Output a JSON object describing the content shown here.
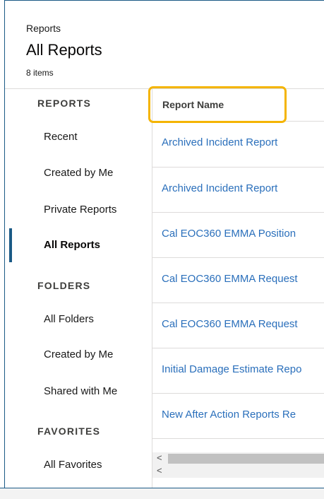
{
  "header": {
    "breadcrumb": "Reports",
    "title": "All Reports",
    "item_count": "8 items"
  },
  "sidebar": {
    "reports_heading": "REPORTS",
    "reports_items": [
      "Recent",
      "Created by Me",
      "Private Reports",
      "All Reports"
    ],
    "folders_heading": "FOLDERS",
    "folders_items": [
      "All Folders",
      "Created by Me",
      "Shared with Me"
    ],
    "favorites_heading": "FAVORITES",
    "favorites_items": [
      "All Favorites"
    ],
    "active_item": "All Reports"
  },
  "table": {
    "column_header": "Report Name",
    "rows": [
      "Archived Incident Report",
      "Archived Incident Report",
      "Cal EOC360 EMMA Position",
      "Cal EOC360 EMMA Request",
      "Cal EOC360 EMMA Request",
      "Initial Damage Estimate Repo",
      "New After Action Reports Re"
    ]
  },
  "scrollbar": {
    "left_arrow": "<"
  },
  "colors": {
    "accent": "#1b5a86",
    "link": "#2a6fbb",
    "highlight": "#f4b400"
  }
}
